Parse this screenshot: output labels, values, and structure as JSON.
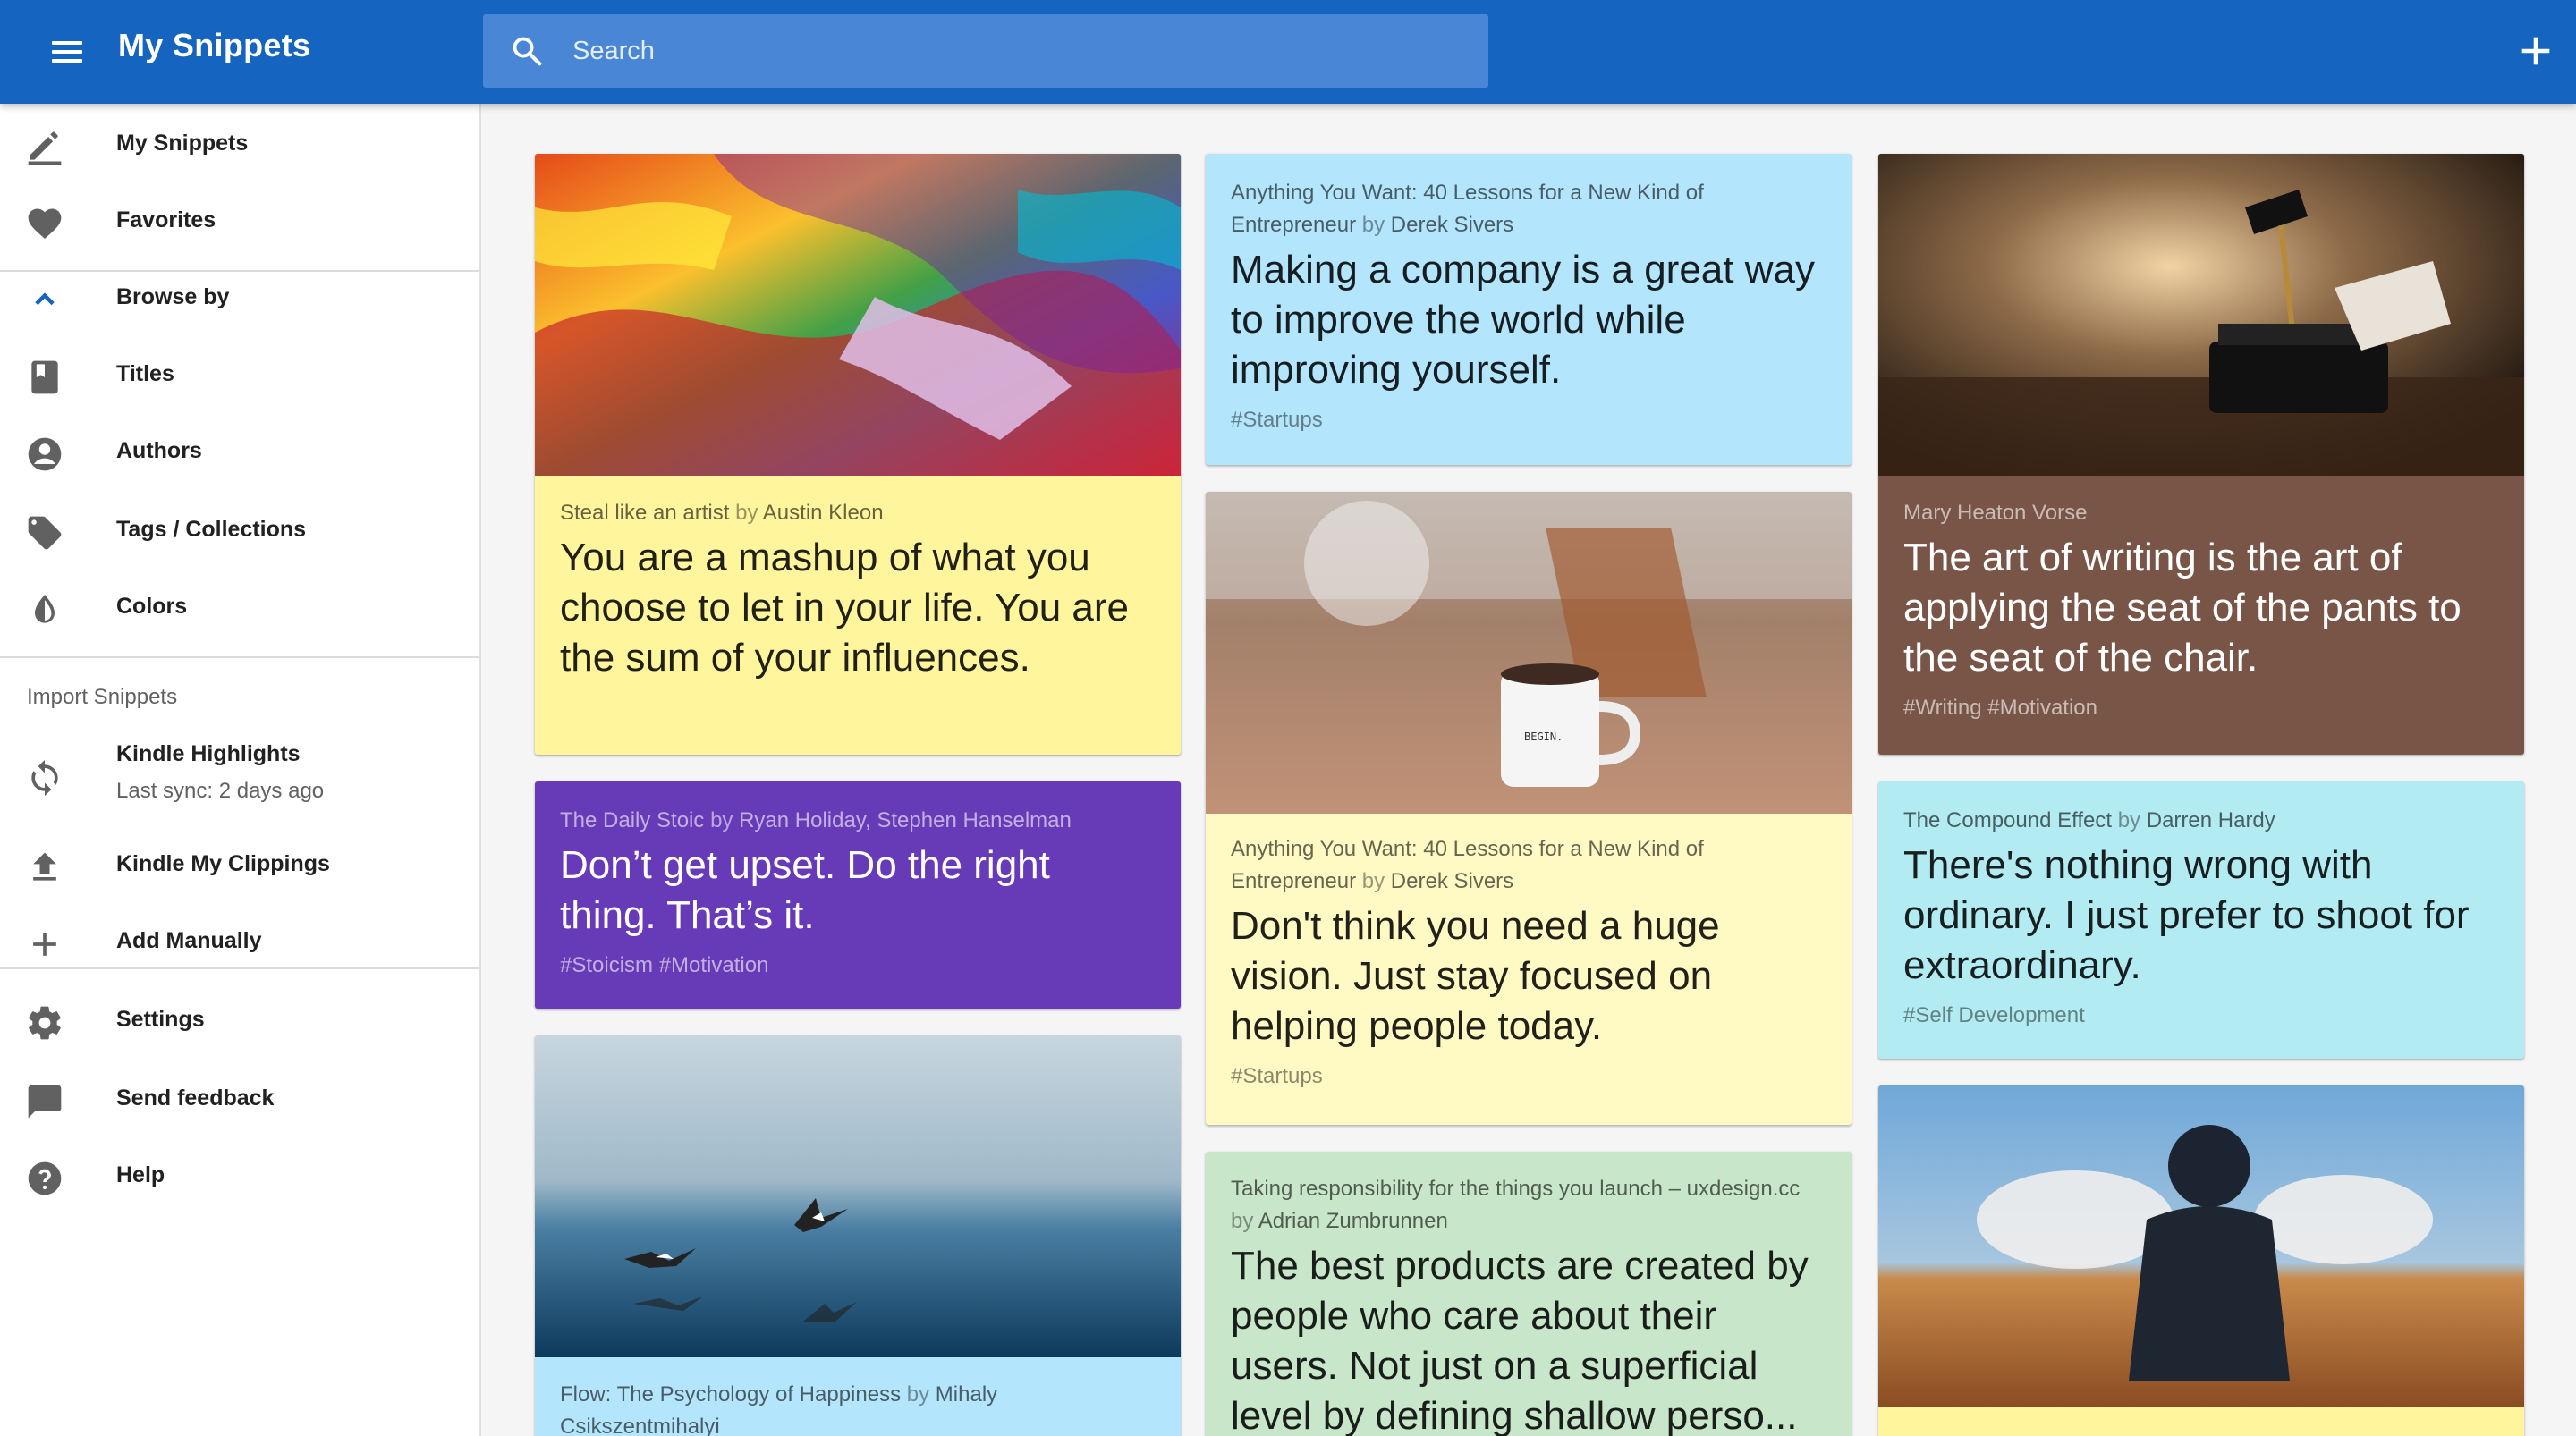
{
  "app": {
    "title": "My Snippets"
  },
  "search": {
    "placeholder": "Search"
  },
  "sidebar": {
    "my_snippets": "My Snippets",
    "favorites": "Favorites",
    "browse_by": "Browse by",
    "titles": "Titles",
    "authors": "Authors",
    "tags": "Tags / Collections",
    "colors": "Colors",
    "import_section": "Import Snippets",
    "kindle_highlights": "Kindle Highlights",
    "last_sync": "Last sync: 2 days ago",
    "kindle_clippings": "Kindle My Clippings",
    "add_manually": "Add Manually",
    "settings": "Settings",
    "send_feedback": "Send feedback",
    "help": "Help"
  },
  "cards": [
    {
      "title": "Steal like an artist",
      "by": "by",
      "author": "Austin Kleon",
      "quote": "You are a mashup of what you choose to let in your life. You are the sum of your influences.",
      "tags": "",
      "color": "#fff59d"
    },
    {
      "title": "The Daily Stoic",
      "by": "by",
      "author": "Ryan Holiday, Stephen Hanselman",
      "quote": "Don’t get upset. Do the right thing. That’s it.",
      "tags": "#Stoicism #Motivation",
      "color": "#673ab7"
    },
    {
      "title": "Flow: The Psychology of Happiness",
      "by": "by",
      "author": "Mihaly Csikszentmihalyi",
      "quote": "",
      "tags": "",
      "color": "#b3e5fc"
    },
    {
      "title": "Anything You Want: 40 Lessons for a New Kind of Entrepreneur",
      "by": "by",
      "author": "Derek Sivers",
      "quote": "Making a company is a great way to improve the world while improving yourself.",
      "tags": "#Startups",
      "color": "#b3e5fc"
    },
    {
      "title": "Anything You Want: 40 Lessons for a New Kind of Entrepreneur",
      "by": "by",
      "author": "Derek Sivers",
      "quote": "Don't think you need a huge vision. Just stay focused on helping people today.",
      "tags": "#Startups",
      "color": "#fff9c4"
    },
    {
      "title": "Taking responsibility for the things you launch – uxdesign.cc",
      "by": "by",
      "author": "Adrian Zumbrunnen",
      "quote": "The best products are created by people who care about their users. Not just on a superficial level by defining shallow perso...",
      "tags": "",
      "color": "#c8e6c9"
    },
    {
      "title": "",
      "by": "",
      "author": "Mary Heaton Vorse",
      "quote": "The art of writing is the art of applying the seat of the pants to the seat of the chair.",
      "tags": "#Writing #Motivation",
      "color": "#795548"
    },
    {
      "title": "The Compound Effect",
      "by": "by",
      "author": "Darren Hardy",
      "quote": "There's nothing wrong with ordinary. I just prefer to shoot for extraordinary.",
      "tags": "#Self Development",
      "color": "#b2ebf2"
    },
    {
      "title": "",
      "by": "",
      "author": "",
      "quote": "",
      "tags": "",
      "color": "#fff59d"
    }
  ],
  "colors": {
    "appbar": "#1565c0",
    "search": "#4a86d6",
    "sidebar_bg": "#ffffff",
    "content_bg": "#f5f5f5"
  },
  "icons": {
    "menu": "menu-icon",
    "search": "search-icon",
    "add": "add-icon",
    "my_snippets": "pencil-icon",
    "favorites": "heart-icon",
    "browse_by": "chevron-up-icon",
    "titles": "book-icon",
    "authors": "account-circle-icon",
    "tags": "tag-icon",
    "colors": "color-drop-icon",
    "kindle_highlights": "sync-icon",
    "kindle_clippings": "upload-icon",
    "add_manually": "plus-icon",
    "settings": "gear-icon",
    "send_feedback": "chat-bubble-icon",
    "help": "help-circle-icon"
  }
}
